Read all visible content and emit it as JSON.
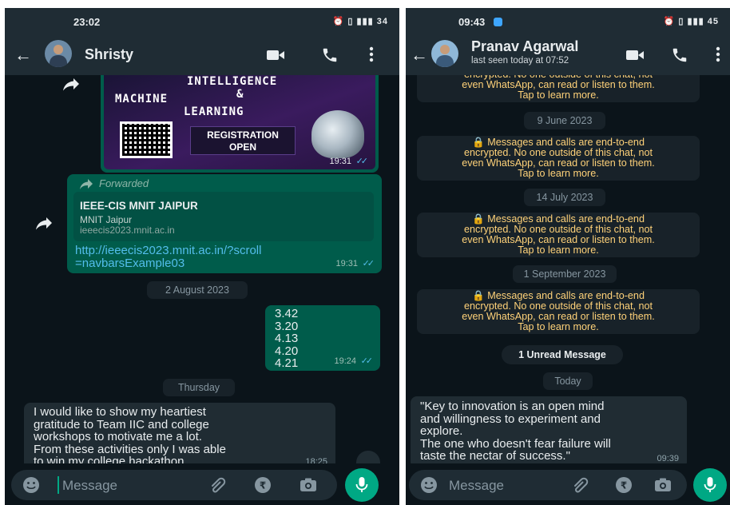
{
  "left": {
    "status": {
      "time": "23:02",
      "battery": "34"
    },
    "header": {
      "name": "Shristy"
    },
    "poster": {
      "line1": "INTELLIGENCE",
      "line2": "&",
      "line3": "MACHINE",
      "line4": "LEARNING",
      "registration": "REGISTRATION\nOPEN",
      "time": "19:31"
    },
    "forward": {
      "label": "Forwarded",
      "card_title": "IEEE-CIS MNIT JAIPUR",
      "card_subtitle": "MNIT Jaipur",
      "card_domain": "ieeecis2023.mnit.ac.in",
      "link": "http://ieeecis2023.mnit.ac.in/?scroll\n=navbarsExample03",
      "time": "19:31"
    },
    "date_divider_1": "2 August 2023",
    "numbers_message": {
      "text": "3.42\n3.20\n4.13\n4.20\n4.21",
      "time": "19:24"
    },
    "date_divider_2": "Thursday",
    "gratitude_message": {
      "text": "I would like to show my heartiest\ngratitude to Team IIC and college\nworkshops to motivate me a lot.\nFrom these activities only I was able\nto win my college hackathon.",
      "time": "18:25"
    },
    "input": {
      "placeholder": "Message"
    }
  },
  "right": {
    "status": {
      "time": "09:43",
      "battery": "45"
    },
    "header": {
      "name": "Pranav Agarwal",
      "last_seen": "last seen today at 07:52"
    },
    "encryption_notice": "🔒 Messages and calls are end-to-end\nencrypted. No one outside of this chat, not\neven WhatsApp, can read or listen to them.\nTap to learn more.",
    "encryption_notice_partial": "🔒 Messages and calls are end-to-end\nencrypted. No one outside of this chat, not\neven WhatsApp, can read or listen to them.\nTap to learn more.",
    "dates": [
      "9 June 2023",
      "14 July 2023",
      "1 September 2023"
    ],
    "unread_label": "1 Unread Message",
    "today_label": "Today",
    "quote_message": {
      "text": "\"Key to innovation is an open mind\nand willingness to experiment and\nexplore.\nThe one who doesn't fear failure will\ntaste the nectar of success.\"",
      "time": "09:39"
    },
    "input": {
      "placeholder": "Message"
    }
  },
  "colors": {
    "background": "#0b141a",
    "header": "#1f2c34",
    "incoming_bubble": "#202c33",
    "outgoing_bubble": "#005c4b",
    "accent": "#00a884",
    "system_text": "#ffd279",
    "link": "#53bdeb"
  }
}
